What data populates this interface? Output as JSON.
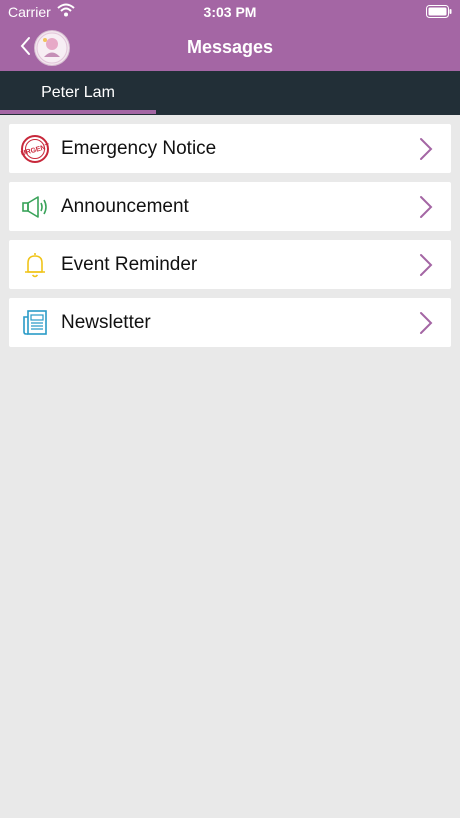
{
  "status": {
    "carrier": "Carrier",
    "time": "3:03 PM"
  },
  "nav": {
    "title": "Messages",
    "back_icon": "chevron-left-icon",
    "avatar": "school-logo-avatar"
  },
  "tabs": [
    {
      "label": "Peter Lam",
      "active": true
    }
  ],
  "items": [
    {
      "label": "Emergency Notice",
      "icon": "urgent-stamp-icon"
    },
    {
      "label": "Announcement",
      "icon": "megaphone-icon"
    },
    {
      "label": "Event Reminder",
      "icon": "bell-icon"
    },
    {
      "label": "Newsletter",
      "icon": "newspaper-icon"
    }
  ],
  "colors": {
    "brand": "#a466a4",
    "tab_bar": "#222f37",
    "background": "#e9e9e9"
  }
}
